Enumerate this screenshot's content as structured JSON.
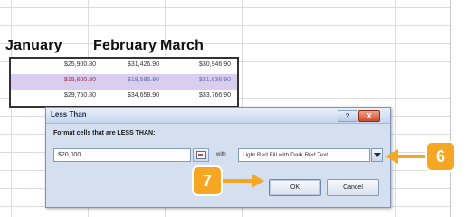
{
  "sheet": {
    "headers": [
      "January",
      "February",
      "March"
    ],
    "rows": [
      [
        "$25,900.80",
        "$31,426.90",
        "$30,946.90"
      ],
      [
        "$15,600.80",
        "$18,585.90",
        "$31,636.90"
      ],
      [
        "$29,750.80",
        "$34,658.90",
        "$33,766.90"
      ]
    ]
  },
  "dialog": {
    "title": "Less Than",
    "help": "?",
    "close": "X",
    "prompt": "Format cells that are LESS THAN:",
    "value": "$20,000",
    "with_label": "with",
    "format_option": "Light Red Fill with Dark Red Text",
    "ok_label": "OK",
    "cancel_label": "Cancel"
  },
  "callouts": {
    "step6": "6",
    "step7": "7",
    "color": "#f5a623"
  },
  "colors": {
    "highlight_row": "#d9cdf0",
    "dialog_bg": "#d4dff0"
  }
}
